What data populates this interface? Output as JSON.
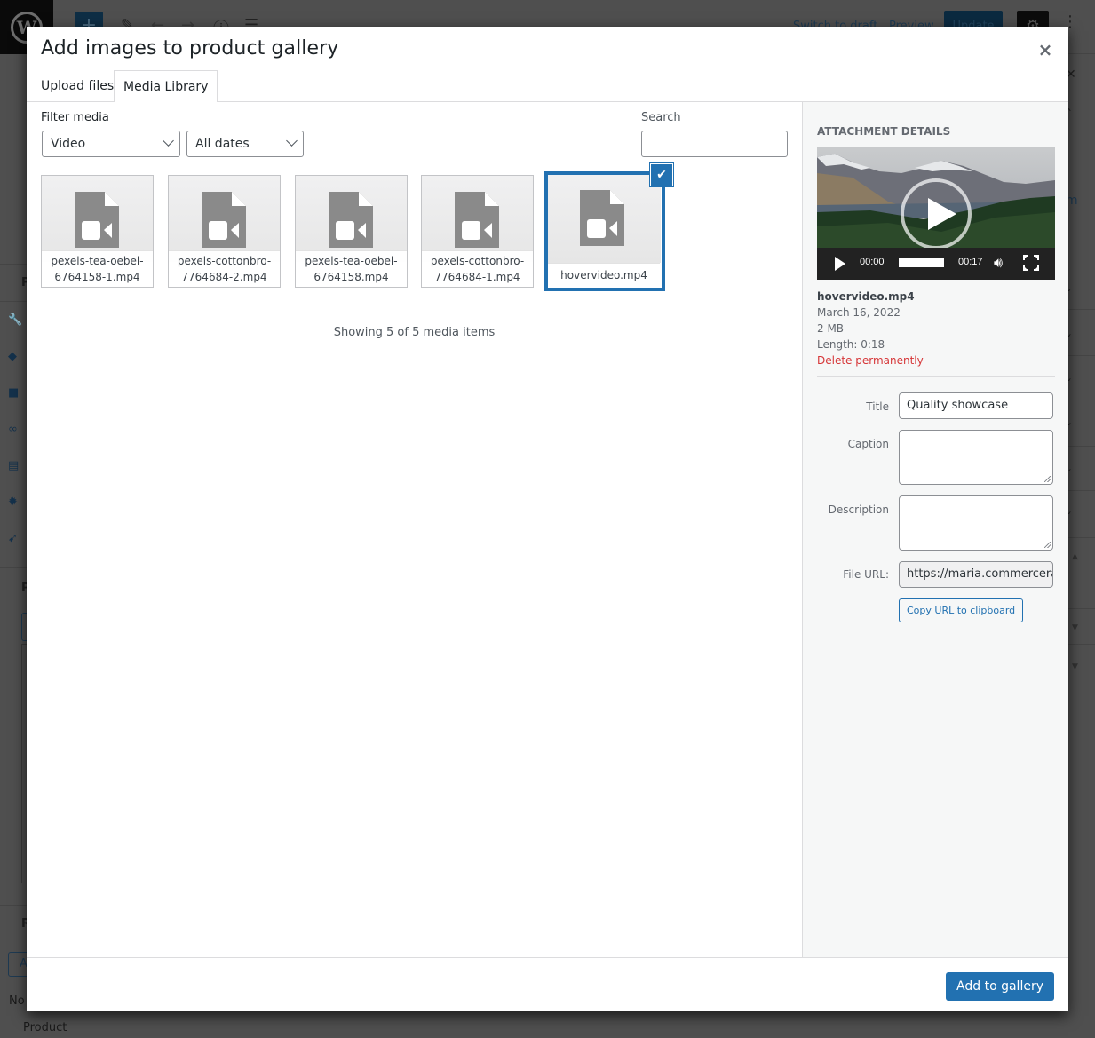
{
  "background": {
    "topbar": {
      "switch_to_draft": "Switch to draft",
      "preview": "Preview",
      "update": "Update"
    },
    "left_partial_texts": [
      "P",
      "P",
      "R",
      "No",
      "Product",
      "A"
    ]
  },
  "modal": {
    "title": "Add images to product gallery",
    "close_label": "×",
    "tabs": [
      {
        "label": "Upload files",
        "active": false
      },
      {
        "label": "Media Library",
        "active": true
      }
    ],
    "filter": {
      "label": "Filter media",
      "type_select": "Video",
      "date_select": "All dates"
    },
    "search": {
      "label": "Search",
      "value": "",
      "placeholder": ""
    },
    "media_items": [
      {
        "line1": "pexels-tea-oebel-",
        "line2": "6764158-1.mp4",
        "selected": false,
        "icon": "video-file-icon"
      },
      {
        "line1": "pexels-cottonbro-",
        "line2": "7764684-2.mp4",
        "selected": false,
        "icon": "video-file-icon"
      },
      {
        "line1": "pexels-tea-oebel-",
        "line2": "6764158.mp4",
        "selected": false,
        "icon": "video-file-icon"
      },
      {
        "line1": "pexels-cottonbro-",
        "line2": "7764684-1.mp4",
        "selected": false,
        "icon": "video-file-icon"
      },
      {
        "line1": "hovervideo.mp4",
        "line2": "",
        "selected": true,
        "icon": "video-file-icon"
      }
    ],
    "count_text": "Showing 5 of 5 media items",
    "attachment": {
      "heading": "Attachment Details",
      "player": {
        "current_time": "00:00",
        "duration": "00:17",
        "progress": 0
      },
      "filename": "hovervideo.mp4",
      "date": "March 16, 2022",
      "size": "2 MB",
      "length": "Length: 0:18",
      "delete_label": "Delete permanently",
      "fields": {
        "title_label": "Title",
        "title_value": "Quality showcase",
        "caption_label": "Caption",
        "caption_value": "",
        "description_label": "Description",
        "description_value": "",
        "file_url_label": "File URL:",
        "file_url_value": "https://maria.commerceran"
      },
      "copy_button": "Copy URL to clipboard"
    },
    "footer": {
      "primary_button": "Add to gallery"
    },
    "colors": {
      "accent": "#2271b1",
      "danger": "#d63638",
      "sidebar_bg": "#f6f7f7"
    }
  }
}
